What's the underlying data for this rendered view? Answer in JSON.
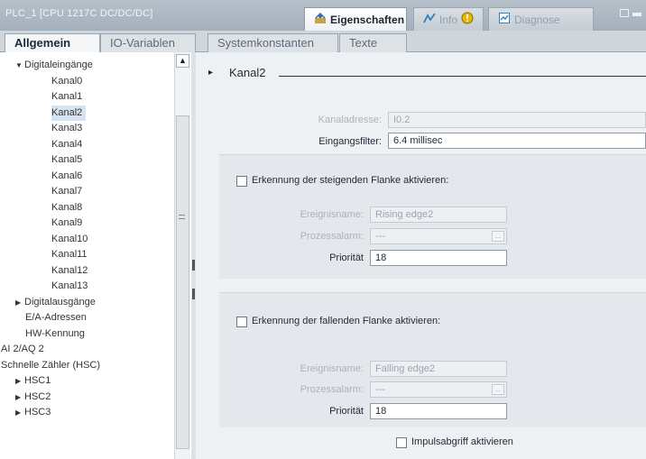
{
  "window": {
    "title": "PLC_1 [CPU 1217C DC/DC/DC]",
    "tabs": [
      {
        "label": "Eigenschaften",
        "icon": "properties-icon",
        "active": true
      },
      {
        "label": "Info",
        "icon": "info-icon",
        "active": false
      },
      {
        "label": "Diagnose",
        "icon": "diagnostics-icon",
        "active": false
      }
    ]
  },
  "subtabs": [
    {
      "label": "Allgemein",
      "active": true
    },
    {
      "label": "IO-Variablen",
      "active": false
    },
    {
      "label": "Systemkonstanten",
      "active": false
    },
    {
      "label": "Texte",
      "active": false
    }
  ],
  "tree": {
    "items": [
      {
        "label": "Digitaleingänge",
        "arrow": "▼",
        "selected": false
      },
      {
        "label": "Kanal0",
        "arrow": "",
        "selected": false
      },
      {
        "label": "Kanal1",
        "arrow": "",
        "selected": false
      },
      {
        "label": "Kanal2",
        "arrow": "",
        "selected": true
      },
      {
        "label": "Kanal3",
        "arrow": "",
        "selected": false
      },
      {
        "label": "Kanal4",
        "arrow": "",
        "selected": false
      },
      {
        "label": "Kanal5",
        "arrow": "",
        "selected": false
      },
      {
        "label": "Kanal6",
        "arrow": "",
        "selected": false
      },
      {
        "label": "Kanal7",
        "arrow": "",
        "selected": false
      },
      {
        "label": "Kanal8",
        "arrow": "",
        "selected": false
      },
      {
        "label": "Kanal9",
        "arrow": "",
        "selected": false
      },
      {
        "label": "Kanal10",
        "arrow": "",
        "selected": false
      },
      {
        "label": "Kanal11",
        "arrow": "",
        "selected": false
      },
      {
        "label": "Kanal12",
        "arrow": "",
        "selected": false
      },
      {
        "label": "Kanal13",
        "arrow": "",
        "selected": false
      },
      {
        "label": "Digitalausgänge",
        "arrow": "▶",
        "selected": false
      },
      {
        "label": "E/A-Adressen",
        "arrow": "",
        "selected": false
      },
      {
        "label": "HW-Kennung",
        "arrow": "",
        "selected": false
      },
      {
        "label": "AI 2/AQ 2",
        "arrow": "▶",
        "selected": false
      },
      {
        "label": "Schnelle Zähler (HSC)",
        "arrow": "▼",
        "selected": false
      },
      {
        "label": "HSC1",
        "arrow": "▶",
        "selected": false
      },
      {
        "label": "HSC2",
        "arrow": "▶",
        "selected": false
      },
      {
        "label": "HSC3",
        "arrow": "▶",
        "selected": false
      }
    ]
  },
  "section": {
    "title": "Kanal2"
  },
  "channel": {
    "address_label": "Kanaladresse:",
    "address_value": "I0.2",
    "filter_label": "Eingangsfilter:",
    "filter_value": "6.4 millisec"
  },
  "rising": {
    "checkbox_label": "Erkennung der steigenden Flanke aktivieren:",
    "event_label": "Ereignisname:",
    "event_value": "Rising edge2",
    "alarm_label": "Prozessalarm:",
    "alarm_value": "---",
    "priority_label": "Priorität",
    "priority_value": "18"
  },
  "falling": {
    "checkbox_label": "Erkennung der fallenden Flanke aktivieren:",
    "event_label": "Ereignisname:",
    "event_value": "Falling edge2",
    "alarm_label": "Prozessalarm:",
    "alarm_value": "---",
    "priority_label": "Priorität",
    "priority_value": "18"
  },
  "pulse": {
    "checkbox_label": "Impulsabgriff aktivieren"
  },
  "colors": {
    "titlebar": "#a9b4bf",
    "selection": "#d6e4f2",
    "panel": "#eef1f4",
    "info_badge": "#e6b800",
    "tree_header_accent": "#1d2935"
  }
}
